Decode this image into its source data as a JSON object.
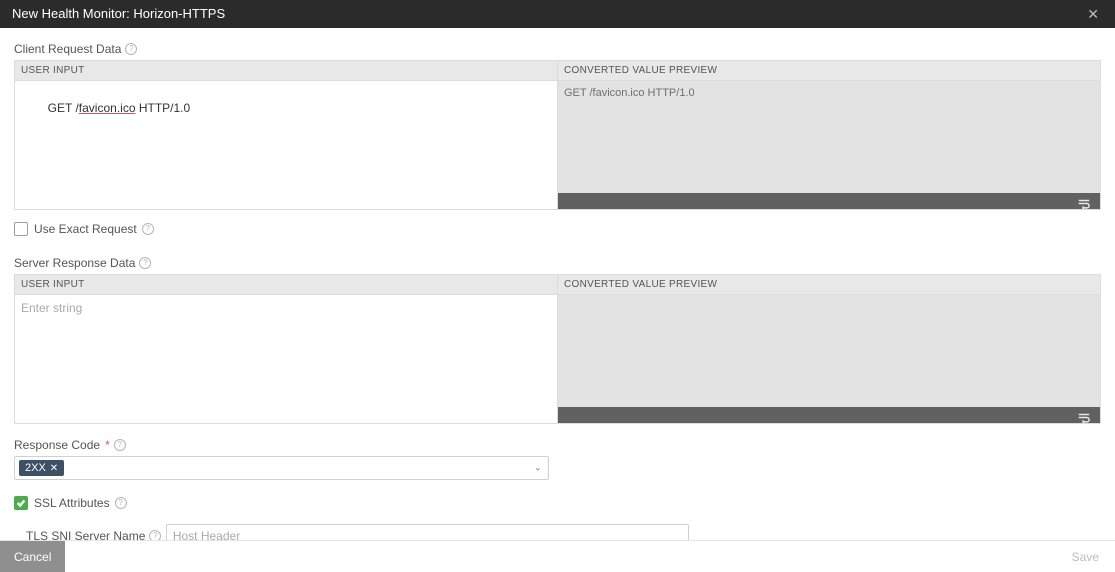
{
  "titlebar": {
    "title": "New Health Monitor: Horizon-HTTPS"
  },
  "help_glyph": "?",
  "client_request": {
    "label": "Client Request Data",
    "user_input_header": "USER INPUT",
    "preview_header": "CONVERTED VALUE PREVIEW",
    "value_prefix": "GET /",
    "value_underlined": "favicon.ico",
    "value_suffix": " HTTP/1.0",
    "preview": "GET /favicon.ico HTTP/1.0"
  },
  "use_exact_request": {
    "label": "Use Exact Request",
    "checked": false
  },
  "server_response": {
    "label": "Server Response Data",
    "user_input_header": "USER INPUT",
    "preview_header": "CONVERTED VALUE PREVIEW",
    "placeholder": "Enter string",
    "preview": ""
  },
  "response_code": {
    "label": "Response Code",
    "pills": [
      {
        "text": "2XX"
      }
    ]
  },
  "ssl_attributes": {
    "label": "SSL Attributes",
    "checked": true
  },
  "tls_sni": {
    "label": "TLS SNI Server Name",
    "placeholder": "Host Header"
  },
  "footer": {
    "cancel": "Cancel",
    "save": "Save"
  }
}
